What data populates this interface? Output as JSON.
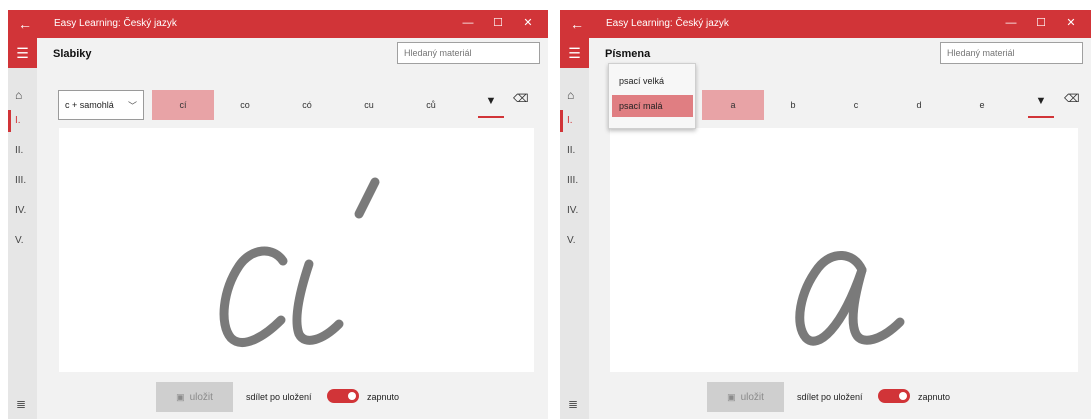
{
  "colors": {
    "accent": "#d13438",
    "selected_chip": "#e8a3a6",
    "menu_highlight": "#e07e82",
    "stroke": "#7a7a7a"
  },
  "left": {
    "titlebar": {
      "back_icon": "arrow-left",
      "title": "Easy Learning: Český jazyk",
      "min": "—",
      "max": "☐",
      "close": "✕"
    },
    "sidebar": {
      "menu_icon": "☰",
      "home_icon": "⌂",
      "items": [
        "I.",
        "II.",
        "III.",
        "IV.",
        "V."
      ],
      "active_index": 0,
      "bottom_icon": "≣"
    },
    "header": {
      "title": "Slabiky",
      "search_placeholder": "Hledaný materiál"
    },
    "toolbar": {
      "dropdown_value": "c + samohlá",
      "chevron": "﹀",
      "chips": [
        "cí",
        "co",
        "có",
        "cu",
        "ců"
      ],
      "selected_index": 0,
      "pen_icon": "▼",
      "eraser_icon": "⌫"
    },
    "footer": {
      "save_label": "uložit",
      "save_icon": "▣",
      "share_label": "sdílet po uložení",
      "toggle_state": "zapnuto",
      "toggle_on": true
    }
  },
  "right": {
    "titlebar": {
      "back_icon": "arrow-left",
      "title": "Easy Learning: Český jazyk",
      "min": "—",
      "max": "☐",
      "close": "✕"
    },
    "sidebar": {
      "menu_icon": "☰",
      "home_icon": "⌂",
      "items": [
        "I.",
        "II.",
        "III.",
        "IV.",
        "V."
      ],
      "active_index": 0,
      "bottom_icon": "≣"
    },
    "header": {
      "title": "Písmena",
      "search_placeholder": "Hledaný materiál"
    },
    "dropdown_menu": {
      "options": [
        "psací velká",
        "psací malá"
      ],
      "selected_index": 1
    },
    "toolbar": {
      "chips": [
        "a",
        "b",
        "c",
        "d",
        "e"
      ],
      "selected_index": 0,
      "pen_icon": "▼",
      "eraser_icon": "⌫"
    },
    "footer": {
      "save_label": "uložit",
      "save_icon": "▣",
      "share_label": "sdílet po uložení",
      "toggle_state": "zapnuto",
      "toggle_on": true
    }
  }
}
